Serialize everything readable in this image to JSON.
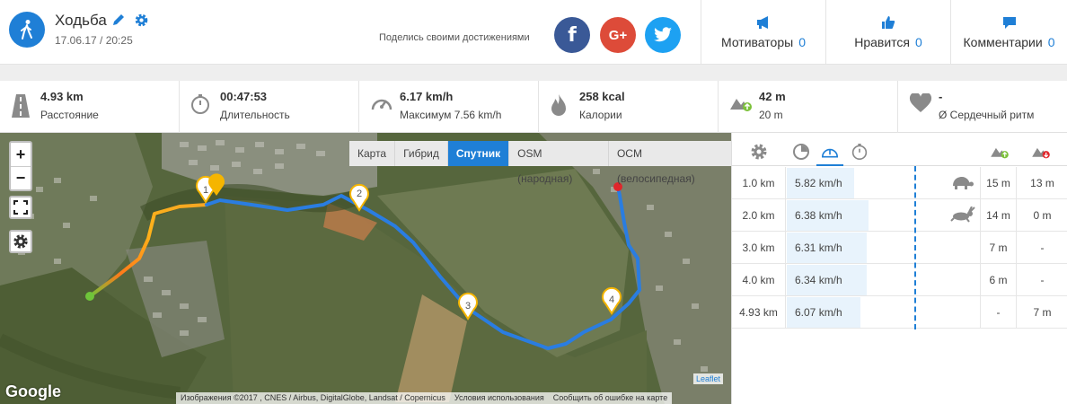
{
  "activity": {
    "title": "Ходьба",
    "date": "17.06.17 / 20:25"
  },
  "share": {
    "text": "Поделись своими достижениями",
    "fb": "f",
    "gplus": "G+"
  },
  "social_stats": [
    {
      "label": "Мотиваторы",
      "count": "0",
      "icon": "megaphone-icon"
    },
    {
      "label": "Нравится",
      "count": "0",
      "icon": "thumbs-up-icon"
    },
    {
      "label": "Комментарии",
      "count": "0",
      "icon": "comment-icon"
    }
  ],
  "metrics": [
    {
      "value": "4.93 km",
      "label": "Расстояние",
      "icon": "road-icon"
    },
    {
      "value": "00:47:53",
      "label": "Длительность",
      "icon": "stopwatch-icon"
    },
    {
      "value": "6.17 km/h",
      "label": "Максимум 7.56 km/h",
      "icon": "speedometer-icon"
    },
    {
      "value": "258 kcal",
      "label": "Калории",
      "icon": "flame-icon"
    },
    {
      "value": "42 m",
      "label": "20 m",
      "icon": "elevation-up-icon"
    },
    {
      "value": "-",
      "label": "Ø Сердечный ритм",
      "icon": "heart-icon"
    }
  ],
  "map": {
    "layers": [
      "Карта",
      "Гибрид",
      "Спутник",
      "OSM (народная)",
      "OCM (велосипедная)"
    ],
    "active_layer": "Спутник",
    "google": "Google",
    "attribution": [
      "Изображения ©2017 , CNES / Airbus, DigitalGlobe, Landsat / Copernicus",
      "Условия использования",
      "Сообщить об ошибке на карте"
    ],
    "leaflet": "Leaflet",
    "markers": [
      "1",
      "2",
      "3",
      "4"
    ],
    "zoom_in": "+",
    "zoom_out": "−"
  },
  "splits": [
    {
      "dist": "1.0 km",
      "speed": "5.82 km/h",
      "speed_value": 5.82,
      "up": "15 m",
      "down": "13 m",
      "pace_icon": "turtle-icon"
    },
    {
      "dist": "2.0 km",
      "speed": "6.38 km/h",
      "speed_value": 6.38,
      "up": "14 m",
      "down": "0 m",
      "pace_icon": "rabbit-icon"
    },
    {
      "dist": "3.0 km",
      "speed": "6.31 km/h",
      "speed_value": 6.31,
      "up": "7 m",
      "down": "-",
      "pace_icon": ""
    },
    {
      "dist": "4.0 km",
      "speed": "6.34 km/h",
      "speed_value": 6.34,
      "up": "6 m",
      "down": "-",
      "pace_icon": ""
    },
    {
      "dist": "4.93 km",
      "speed": "6.07 km/h",
      "speed_value": 6.07,
      "up": "-",
      "down": "7 m",
      "pace_icon": ""
    }
  ],
  "colors": {
    "accent": "#1f7fd6",
    "route": "#2a7de1",
    "start": "#6fc43a",
    "end": "#e0262b"
  }
}
